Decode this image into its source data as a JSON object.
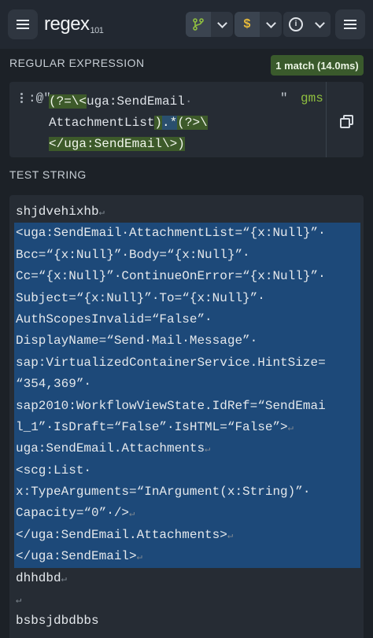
{
  "app": {
    "logo_text": "regex",
    "logo_version": "101"
  },
  "toolbar": {
    "flavor_icon": "branch-icon",
    "function_symbol": "$",
    "info_symbol": "i"
  },
  "regex": {
    "section_label": "REGULAR EXPRESSION",
    "match_badge": "1 match (14.0ms)",
    "delimiter_open": ":@\"",
    "delimiter_close": "\"",
    "flags": "gms",
    "line1_grp_open": "(?=\\<",
    "line1_text": "uga:SendEmail",
    "line2_text": "AttachmentList",
    "line2_grp_close": ")",
    "line2_dotstar": ".*",
    "line2_lazy_open": "(?>\\",
    "line3_text": "</uga:SendEmail\\>)",
    "copy_icon": "copy-icon"
  },
  "test": {
    "section_label": "TEST STRING",
    "lines": [
      {
        "text": "shjdvehixhb",
        "match": false
      },
      {
        "text": "<uga:SendEmail·AttachmentList=“{x:Null}”·",
        "match": true
      },
      {
        "text": "Bcc=“{x:Null}”·Body=“{x:Null}”·",
        "match": true
      },
      {
        "text": "Cc=“{x:Null}”·ContinueOnError=“{x:Null}”·",
        "match": true
      },
      {
        "text": "Subject=“{x:Null}”·To=“{x:Null}”·",
        "match": true
      },
      {
        "text": "AuthScopesInvalid=“False”·",
        "match": true
      },
      {
        "text": "DisplayName=“Send·Mail·Message”·",
        "match": true
      },
      {
        "text": "sap:VirtualizedContainerService.HintSize=",
        "match": true
      },
      {
        "text": "“354,369”·",
        "match": true
      },
      {
        "text": "sap2010:WorkflowViewState.IdRef=“SendEmai",
        "match": true
      },
      {
        "text": "l_1”·IsDraft=“False”·IsHTML=“False”>",
        "match": true
      },
      {
        "text": "uga:SendEmail.Attachments",
        "match": true
      },
      {
        "text": "<scg:List·",
        "match": true
      },
      {
        "text": "x:TypeArguments=“InArgument(x:String)”·",
        "match": true
      },
      {
        "text": "Capacity=“0”·/>",
        "match": true
      },
      {
        "text": "</uga:SendEmail.Attachments>",
        "match": true
      },
      {
        "text": "</uga:SendEmail>",
        "match": true
      },
      {
        "text": "dhhdbd",
        "match": false
      },
      {
        "text": "",
        "match": false
      },
      {
        "text": "bsbsjdbdbbs",
        "match": false
      }
    ],
    "return_glyph": "↵"
  }
}
